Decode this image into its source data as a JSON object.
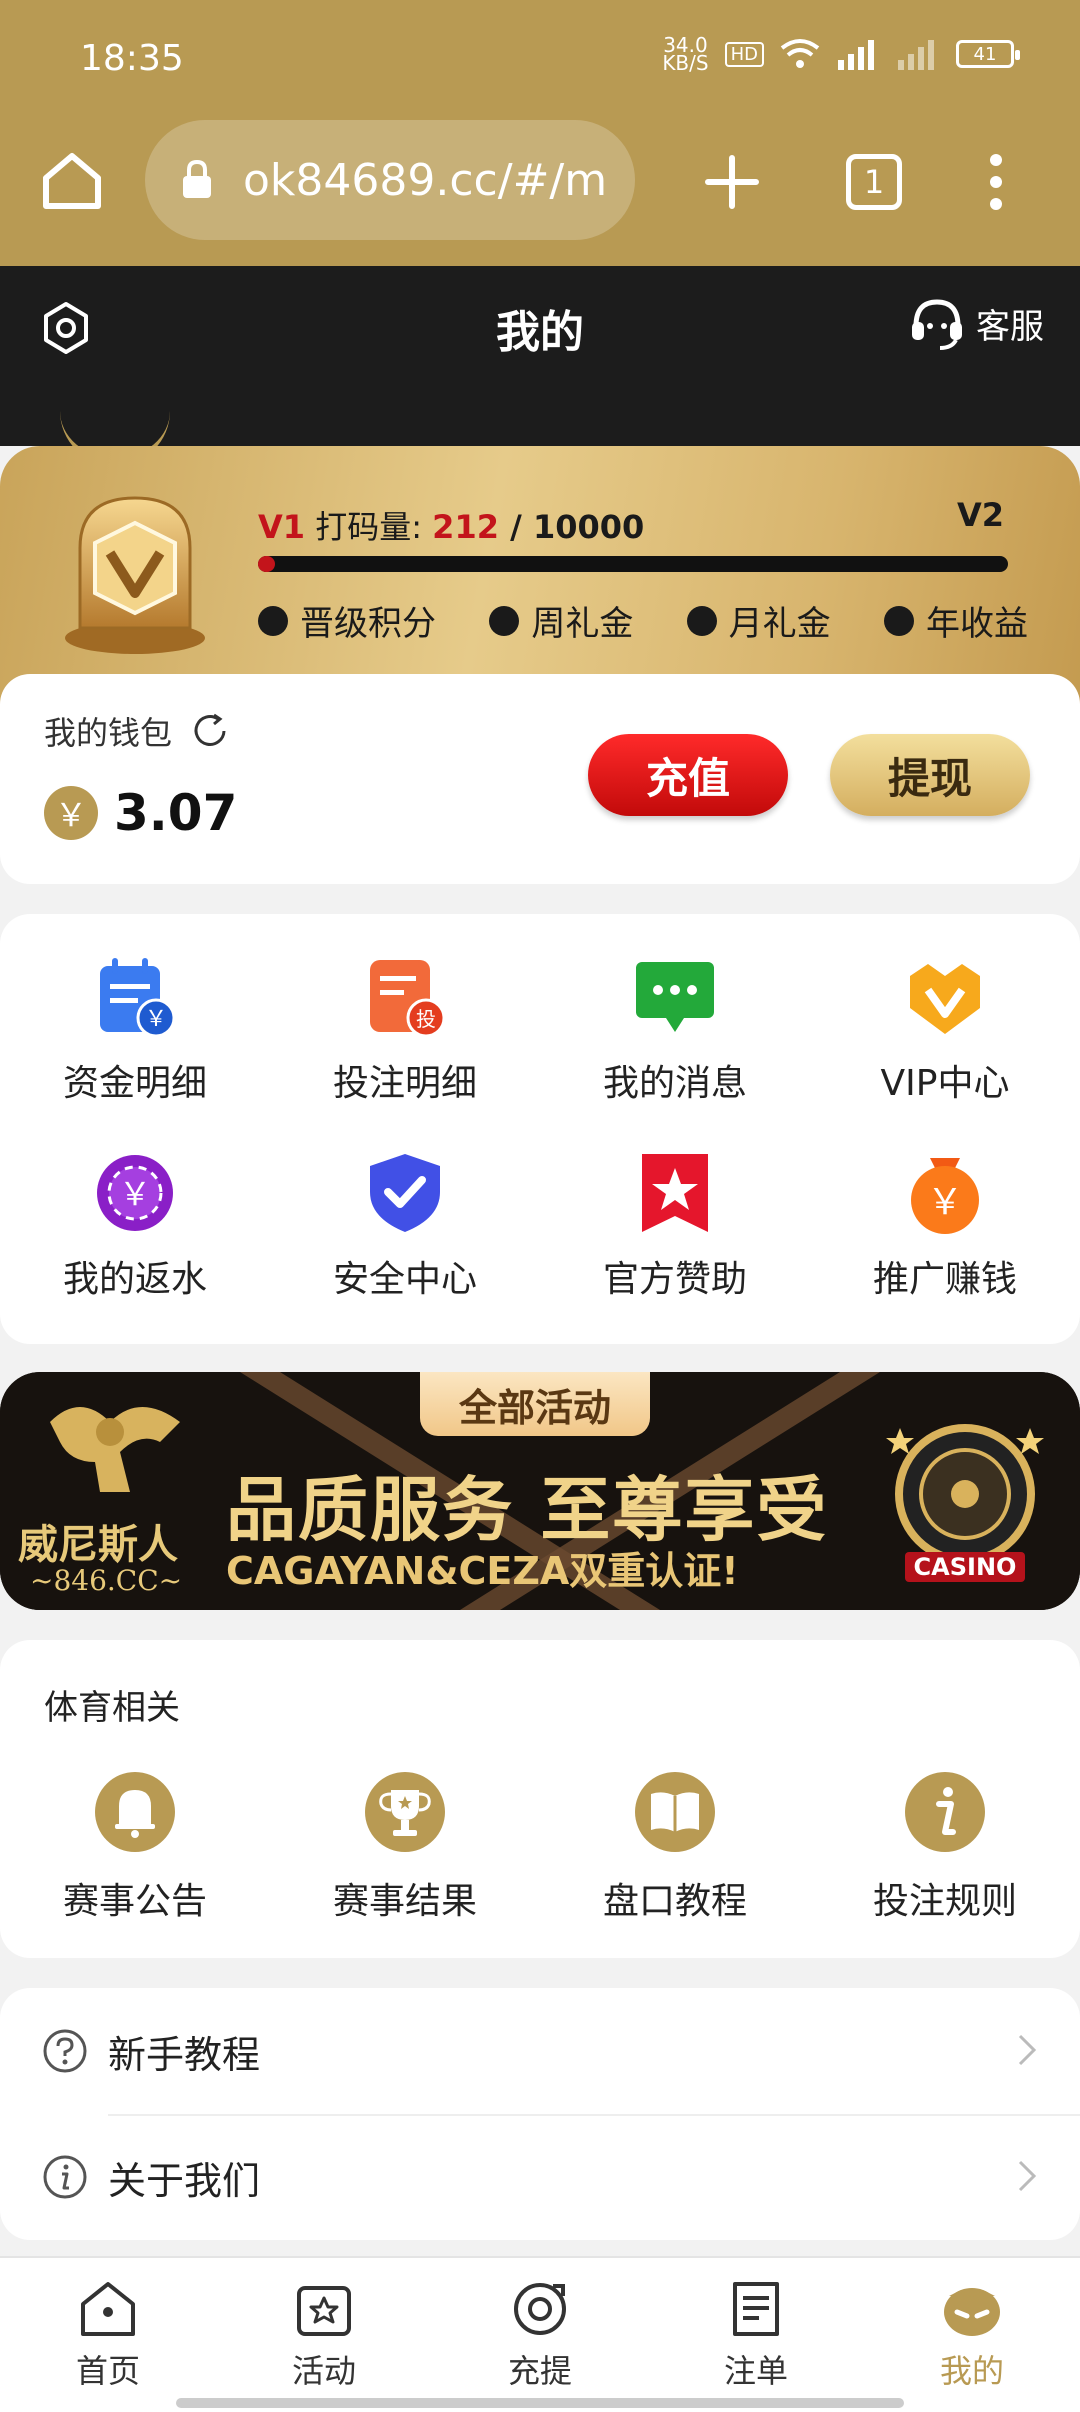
{
  "status_bar": {
    "time": "18:35",
    "net_speed_value": "34.0",
    "net_speed_unit": "KB/S",
    "hd_label": "HD",
    "battery": "41"
  },
  "browser": {
    "url": "ok84689.cc/#/m",
    "tab_count": "1"
  },
  "header": {
    "title": "我的",
    "service_label": "客服"
  },
  "vip": {
    "level": "V1",
    "progress_label": "打码量:",
    "current": "212",
    "separator": " / ",
    "target": "10000",
    "next_level": "V2",
    "progress_fraction": 0.0212,
    "perks": [
      "晋级积分",
      "周礼金",
      "月礼金",
      "年收益"
    ]
  },
  "wallet": {
    "title": "我的钱包",
    "currency_symbol": "￥",
    "balance": "3.07",
    "recharge_label": "充值",
    "withdraw_label": "提现"
  },
  "grid_menu": [
    {
      "label": "资金明细",
      "icon": "fund-details-icon"
    },
    {
      "label": "投注明细",
      "icon": "bet-details-icon"
    },
    {
      "label": "我的消息",
      "icon": "messages-icon"
    },
    {
      "label": "VIP中心",
      "icon": "vip-center-icon"
    },
    {
      "label": "我的返水",
      "icon": "rebate-icon"
    },
    {
      "label": "安全中心",
      "icon": "security-icon"
    },
    {
      "label": "官方赞助",
      "icon": "sponsor-icon"
    },
    {
      "label": "推广赚钱",
      "icon": "promote-icon"
    }
  ],
  "banner": {
    "tag": "全部活动",
    "brand": "威尼斯人",
    "domain": "~846.CC~",
    "slogan": "品质服务 至尊享受",
    "subtitle": "CAGAYAN&CEZA双重认证!",
    "chip_label": "CASINO"
  },
  "sports": {
    "title": "体育相关",
    "items": [
      {
        "label": "赛事公告",
        "icon": "bell-icon"
      },
      {
        "label": "赛事结果",
        "icon": "trophy-icon"
      },
      {
        "label": "盘口教程",
        "icon": "book-icon"
      },
      {
        "label": "投注规则",
        "icon": "info-icon"
      }
    ]
  },
  "list": [
    {
      "label": "新手教程",
      "icon": "question-icon"
    },
    {
      "label": "关于我们",
      "icon": "info-outline-icon"
    }
  ],
  "bottom_nav": [
    {
      "label": "首页",
      "icon": "home-icon"
    },
    {
      "label": "活动",
      "icon": "activity-icon"
    },
    {
      "label": "充提",
      "icon": "deposit-withdraw-icon"
    },
    {
      "label": "注单",
      "icon": "bet-slip-icon"
    },
    {
      "label": "我的",
      "icon": "profile-icon",
      "active": true
    }
  ],
  "colors": {
    "accent_gold": "#b89a53",
    "header_dark": "#1c1c1c",
    "recharge_red": "#c20a0a"
  }
}
